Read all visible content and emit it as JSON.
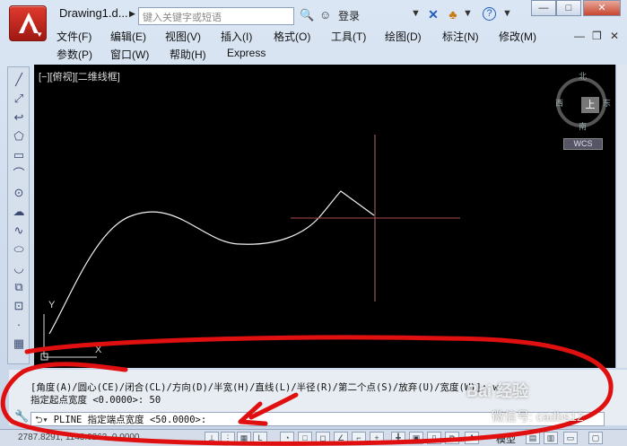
{
  "titlebar": {
    "doc_title": "Drawing1.d...",
    "search_placeholder": "键入关键字或短语",
    "login": "登录"
  },
  "menus": {
    "row1": [
      "文件(F)",
      "编辑(E)",
      "视图(V)",
      "插入(I)",
      "格式(O)",
      "工具(T)",
      "绘图(D)",
      "标注(N)",
      "修改(M)"
    ],
    "row2": [
      "参数(P)",
      "窗口(W)",
      "帮助(H)",
      "Express"
    ]
  },
  "viewport": {
    "label": "[−][俯视][二维线框]",
    "compass": {
      "north": "北",
      "south": "南",
      "east": "东",
      "west": "西",
      "top": "上"
    },
    "wcs": "WCS",
    "ucs_y": "Y",
    "ucs_x": "X"
  },
  "command": {
    "history1": "[角度(A)/圆心(CE)/闭合(CL)/方向(D)/半宽(H)/直线(L)/半径(R)/第二个点(S)/放弃(U)/宽度(W)]: w",
    "history2": "指定起点宽度 <0.0000>: 50",
    "prompt": "PLINE 指定端点宽度 <50.0000>:"
  },
  "statusbar": {
    "coords": "2787.8291, 1143.0263, 0.0000",
    "model": "模型"
  },
  "watermark": {
    "baidu": "Bai 经验",
    "wechat": "微信号: cadbs12"
  },
  "colors": {
    "canvas": "#000000",
    "annotation": "#e01010",
    "crosshair": "#b04a50",
    "curve": "#ffffff"
  }
}
